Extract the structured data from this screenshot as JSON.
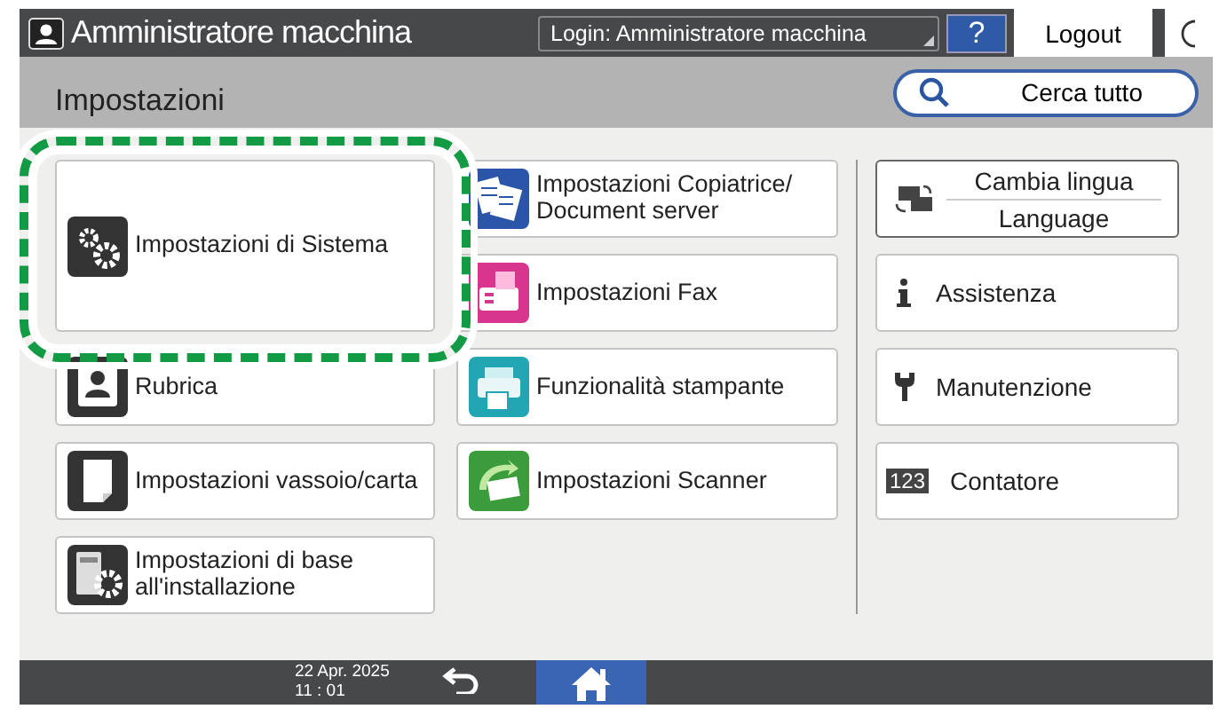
{
  "top_bar": {
    "user": "Amministratore macchina",
    "login": "Login: Amministratore macchina",
    "help": "?",
    "logout": "Logout"
  },
  "header": {
    "title": "Impostazioni",
    "search": "Cerca tutto"
  },
  "tiles": [
    {
      "label": "Impostazioni di Sistema",
      "highlighted": true
    },
    {
      "label": "Rubrica",
      "highlighted": false
    },
    {
      "label": "Impostazioni vassoio/carta",
      "highlighted": false
    },
    {
      "label": "Impostazioni di base\nall'installazione",
      "highlighted": false
    },
    {
      "label": "Impostazioni Copiatrice/\nDocument server",
      "highlighted": false
    },
    {
      "label": "Impostazioni Fax",
      "highlighted": false
    },
    {
      "label": "Funzionalità stampante",
      "highlighted": false
    },
    {
      "label": "Impostazioni Scanner",
      "highlighted": false
    }
  ],
  "side": {
    "language": [
      "Cambia lingua",
      "Language"
    ],
    "items": [
      "Assistenza",
      "Manutenzione",
      "Contatore"
    ],
    "counter_icon": "123"
  },
  "bottom_bar": {
    "date": "22 Apr. 2025",
    "time": "11 : 01",
    "home_selected": true
  }
}
